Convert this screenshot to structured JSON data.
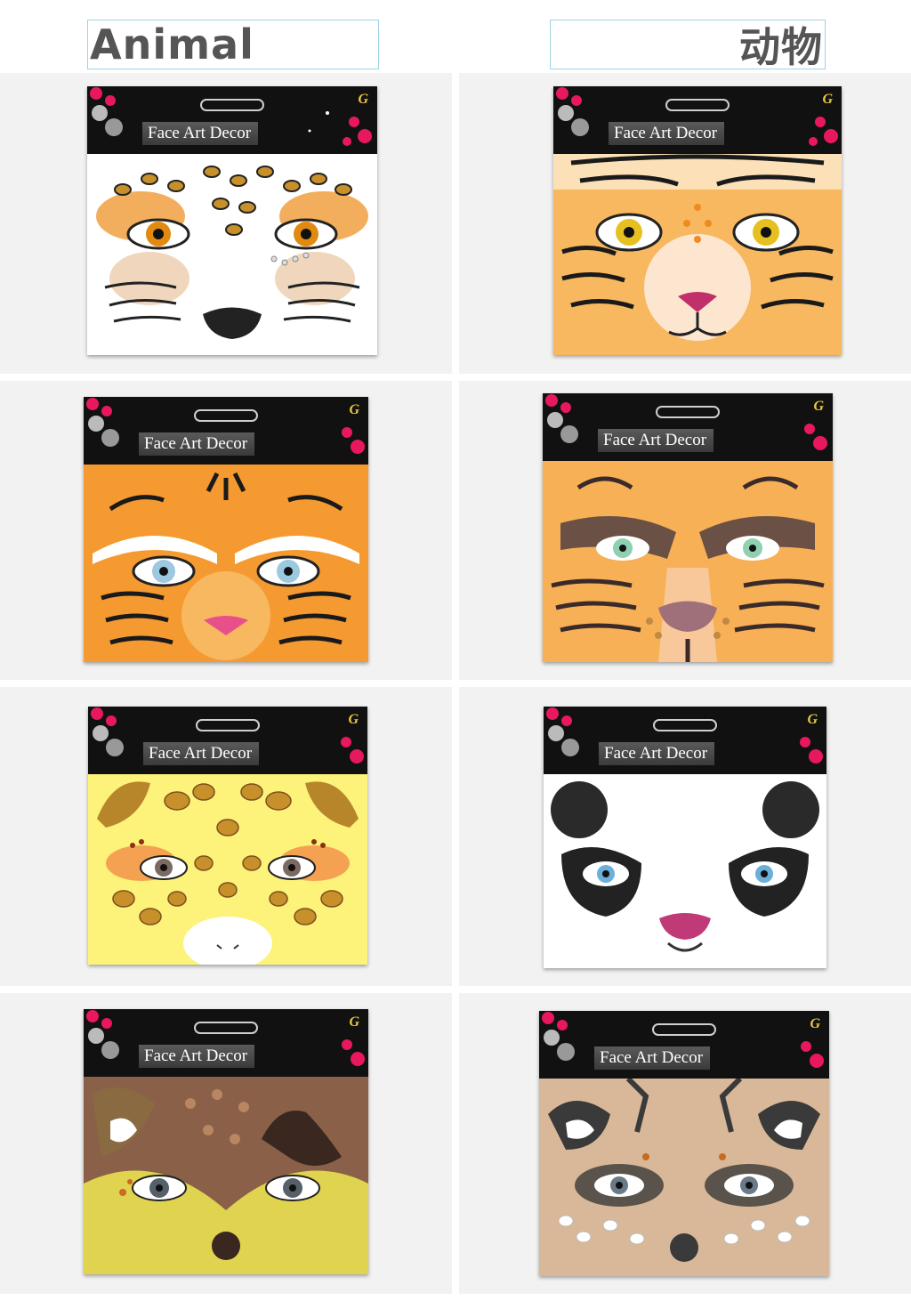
{
  "headers": {
    "en": "Animal",
    "zh": "动物"
  },
  "brand": {
    "label": "Face Art Decor",
    "logo": "G"
  },
  "colors": {
    "accent_pink": "#e8185e",
    "frame": "#9fd3e6",
    "heading": "#555555",
    "cell_bg": "#f2f2f2"
  },
  "products": [
    {
      "animal": "leopard-icon"
    },
    {
      "animal": "tiger-icon"
    },
    {
      "animal": "orange-tiger-icon"
    },
    {
      "animal": "tabby-cat-icon"
    },
    {
      "animal": "giraffe-icon"
    },
    {
      "animal": "panda-icon"
    },
    {
      "animal": "fawn-icon"
    },
    {
      "animal": "reindeer-icon"
    }
  ]
}
